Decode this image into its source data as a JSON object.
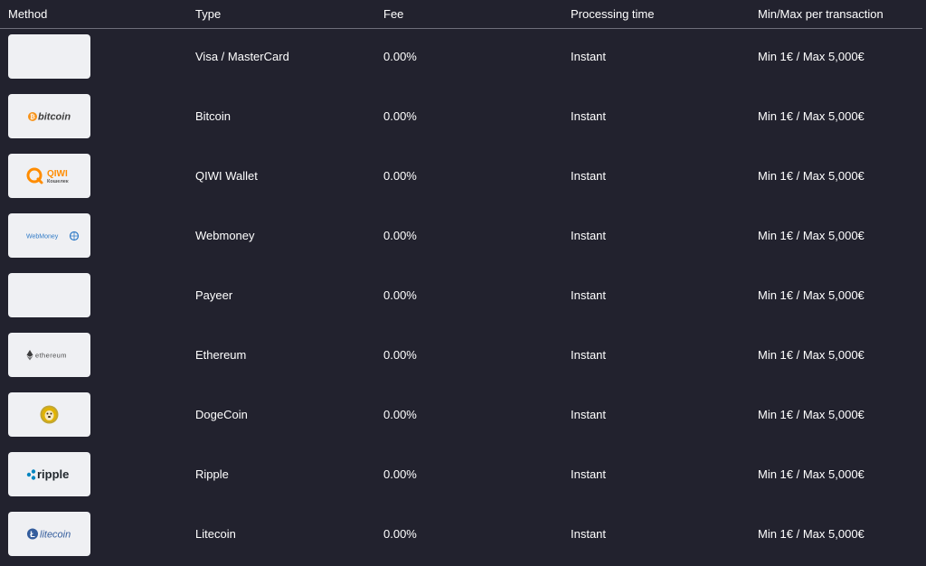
{
  "header": {
    "method": "Method",
    "type": "Type",
    "fee": "Fee",
    "processing_time": "Processing time",
    "min_max": "Min/Max per transaction"
  },
  "colors": {
    "background": "#22222e",
    "logo_box": "#eff0f3",
    "divider": "#6e6e7a",
    "bitcoin": "#f7931a",
    "qiwi": "#ff8c00",
    "webmoney": "#2f7ac6",
    "ripple": "#23292f",
    "litecoin": "#345d9d"
  },
  "logos": {
    "bitcoin": "bitcoin",
    "qiwi": "QIWI",
    "qiwi_sub": "Кошелек",
    "webmoney": "WebMoney",
    "ethereum": "ethereum",
    "ripple": "ripple",
    "litecoin": "litecoin"
  },
  "rows": [
    {
      "logo_icon": "visa-mastercard-logo",
      "type": "Visa / MasterCard",
      "fee": "0.00%",
      "time": "Instant",
      "minmax": "Min 1€ / Max 5,000€"
    },
    {
      "logo_icon": "bitcoin-logo",
      "type": "Bitcoin",
      "fee": "0.00%",
      "time": "Instant",
      "minmax": "Min 1€ / Max 5,000€"
    },
    {
      "logo_icon": "qiwi-logo",
      "type": "QIWI Wallet",
      "fee": "0.00%",
      "time": "Instant",
      "minmax": "Min 1€ / Max 5,000€"
    },
    {
      "logo_icon": "webmoney-logo",
      "type": "Webmoney",
      "fee": "0.00%",
      "time": "Instant",
      "minmax": "Min 1€ / Max 5,000€"
    },
    {
      "logo_icon": "payeer-logo",
      "type": "Payeer",
      "fee": "0.00%",
      "time": "Instant",
      "minmax": "Min 1€ / Max 5,000€"
    },
    {
      "logo_icon": "ethereum-logo",
      "type": "Ethereum",
      "fee": "0.00%",
      "time": "Instant",
      "minmax": "Min 1€ / Max 5,000€"
    },
    {
      "logo_icon": "dogecoin-logo",
      "type": "DogeCoin",
      "fee": "0.00%",
      "time": "Instant",
      "minmax": "Min 1€ / Max 5,000€"
    },
    {
      "logo_icon": "ripple-logo",
      "type": "Ripple",
      "fee": "0.00%",
      "time": "Instant",
      "minmax": "Min 1€ / Max 5,000€"
    },
    {
      "logo_icon": "litecoin-logo",
      "type": "Litecoin",
      "fee": "0.00%",
      "time": "Instant",
      "minmax": "Min 1€ / Max 5,000€"
    }
  ]
}
